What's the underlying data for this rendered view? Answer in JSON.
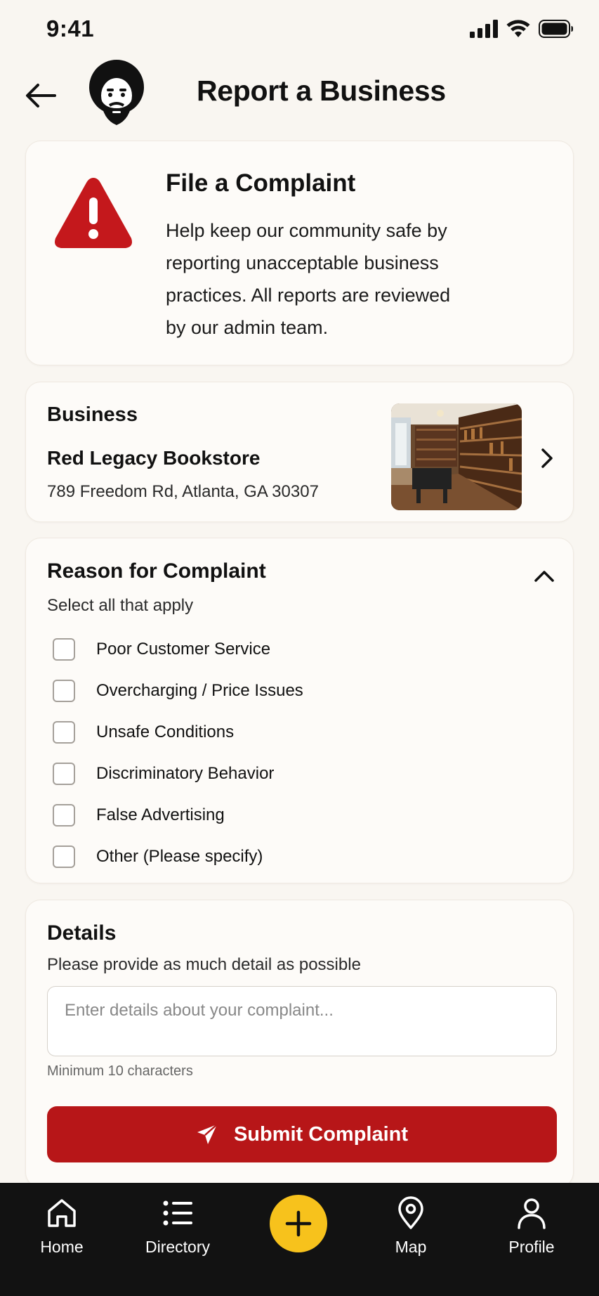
{
  "status_bar": {
    "time": "9:41"
  },
  "header": {
    "title": "Report a Business"
  },
  "complaint_card": {
    "title": "File a Complaint",
    "description": "Help keep our community safe by reporting unacceptable business practices. All reports are reviewed by our admin team."
  },
  "business": {
    "heading": "Business",
    "name": "Red Legacy Bookstore",
    "address": "789 Freedom Rd, Atlanta, GA 30307"
  },
  "reason": {
    "title": "Reason for Complaint",
    "subtitle": "Select all that apply",
    "options": [
      {
        "label": "Poor Customer Service",
        "checked": false
      },
      {
        "label": "Overcharging / Price Issues",
        "checked": false
      },
      {
        "label": "Unsafe Conditions",
        "checked": false
      },
      {
        "label": "Discriminatory Behavior",
        "checked": false
      },
      {
        "label": "False Advertising",
        "checked": false
      },
      {
        "label": "Other (Please specify)",
        "checked": false
      }
    ]
  },
  "details": {
    "title": "Details",
    "subtitle": "Please provide as much detail as possible",
    "placeholder": "Enter details about your complaint...",
    "value": "",
    "hint": "Minimum 10 characters"
  },
  "submit": {
    "label": "Submit Complaint"
  },
  "tab_bar": {
    "tabs": [
      {
        "label": "Home",
        "icon": "home-icon"
      },
      {
        "label": "Directory",
        "icon": "list-icon"
      },
      {
        "label": "",
        "icon": "plus-icon"
      },
      {
        "label": "Map",
        "icon": "map-pin-icon"
      },
      {
        "label": "Profile",
        "icon": "person-icon"
      }
    ]
  },
  "colors": {
    "accent_red": "#b71618",
    "fab_yellow": "#f7c21c",
    "tab_bar_bg": "#121212",
    "page_bg": "#f9f6f1"
  }
}
